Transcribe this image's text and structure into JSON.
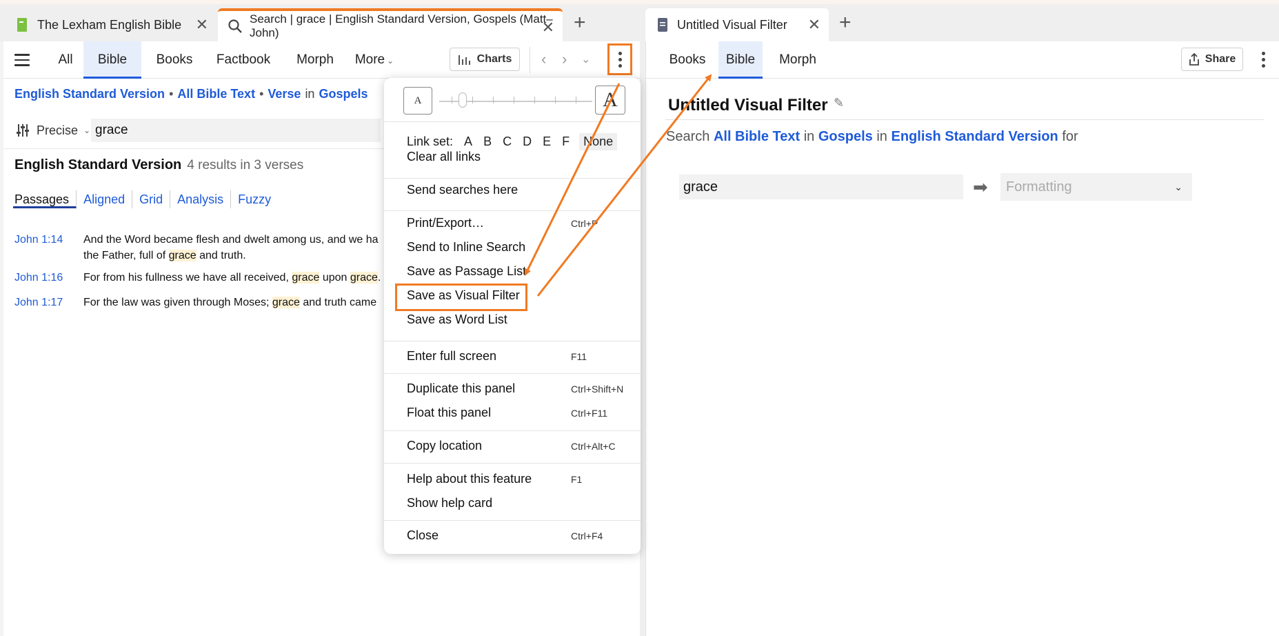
{
  "tabs": [
    {
      "title": "The Lexham English Bible"
    },
    {
      "title": "Search | grace | English Standard Version, Gospels (Matt–John)"
    },
    {
      "title": "Untitled Visual Filter"
    }
  ],
  "left_panel": {
    "nav": [
      "All",
      "Bible",
      "Books",
      "Factbook",
      "Morph",
      "More"
    ],
    "charts_label": "Charts",
    "breadcrumb": {
      "version": "English Standard Version",
      "text": "All Bible Text",
      "unit": "Verse",
      "in": "in",
      "range": "Gospels"
    },
    "mode": "Precise",
    "query": "grace",
    "results": {
      "version": "English Standard Version",
      "summary": "4 results in 3 verses"
    },
    "subtabs": [
      "Passages",
      "Aligned",
      "Grid",
      "Analysis",
      "Fuzzy"
    ],
    "verses": [
      {
        "ref": "John 1:14",
        "line1": "And the Word became flesh and dwelt among us, and we ha",
        "line2a": "the Father, full of ",
        "hl": "grace",
        "line2b": " and truth."
      },
      {
        "ref": "John 1:16",
        "a": "For from his fullness we have all received, ",
        "hl1": "grace",
        "b": " upon ",
        "hl2": "grace",
        "c": "."
      },
      {
        "ref": "John 1:17",
        "a": "For the law was given through Moses; ",
        "hl": "grace",
        "b": " and truth came"
      }
    ]
  },
  "menu": {
    "zoom_small": "A",
    "zoom_large": "A",
    "linkset_label": "Link set:",
    "linkset_options": [
      "A",
      "B",
      "C",
      "D",
      "E",
      "F",
      "None"
    ],
    "items": [
      {
        "label": "Clear all links",
        "shortcut": ""
      },
      {
        "label": "Send searches here",
        "shortcut": ""
      },
      {
        "label": "Print/Export…",
        "shortcut": "Ctrl+P"
      },
      {
        "label": "Send to Inline Search",
        "shortcut": ""
      },
      {
        "label": "Save as Passage List",
        "shortcut": ""
      },
      {
        "label": "Save as Visual Filter",
        "shortcut": ""
      },
      {
        "label": "Save as Word List",
        "shortcut": ""
      },
      {
        "label": "Enter full screen",
        "shortcut": "F11"
      },
      {
        "label": "Duplicate this panel",
        "shortcut": "Ctrl+Shift+N"
      },
      {
        "label": "Float this panel",
        "shortcut": "Ctrl+F11"
      },
      {
        "label": "Copy location",
        "shortcut": "Ctrl+Alt+C"
      },
      {
        "label": "Help about this feature",
        "shortcut": "F1"
      },
      {
        "label": "Show help card",
        "shortcut": ""
      },
      {
        "label": "Close",
        "shortcut": "Ctrl+F4"
      }
    ]
  },
  "right_panel": {
    "nav": [
      "Books",
      "Bible",
      "Morph"
    ],
    "share_label": "Share",
    "title": "Untitled Visual Filter",
    "desc": {
      "search": "Search",
      "text": "All Bible Text",
      "in1": "in",
      "range": "Gospels",
      "in2": "in",
      "version": "English Standard Version",
      "for": "for"
    },
    "query": "grace",
    "format_placeholder": "Formatting"
  },
  "colors": {
    "accent": "#f07a22",
    "link": "#1e5bd8",
    "highlight": "#fdf2d4"
  }
}
